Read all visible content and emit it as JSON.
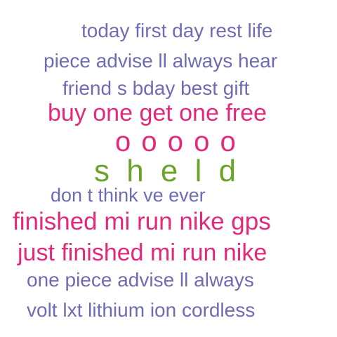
{
  "colors": {
    "purple": "#6f6cb4",
    "pink": "#e4287a",
    "green": "#6aa52a",
    "background": "#ffffff"
  },
  "phrases": [
    {
      "text": "today first day rest life",
      "color": "purple"
    },
    {
      "text": "piece advise ll always hear",
      "color": "purple"
    },
    {
      "text": "friend s bday best gift",
      "color": "purple"
    },
    {
      "text": "buy one get one free",
      "color": "pink"
    },
    {
      "text": "o o o o o",
      "color": "pink"
    },
    {
      "text": "s h e l d",
      "color": "green"
    },
    {
      "text": "don t think ve ever",
      "color": "purple"
    },
    {
      "text": "finished mi run nike gps",
      "color": "pink"
    },
    {
      "text": "just finished mi run nike",
      "color": "pink"
    },
    {
      "text": "one piece advise ll always",
      "color": "purple"
    },
    {
      "text": "volt lxt lithium ion cordless",
      "color": "purple"
    }
  ]
}
